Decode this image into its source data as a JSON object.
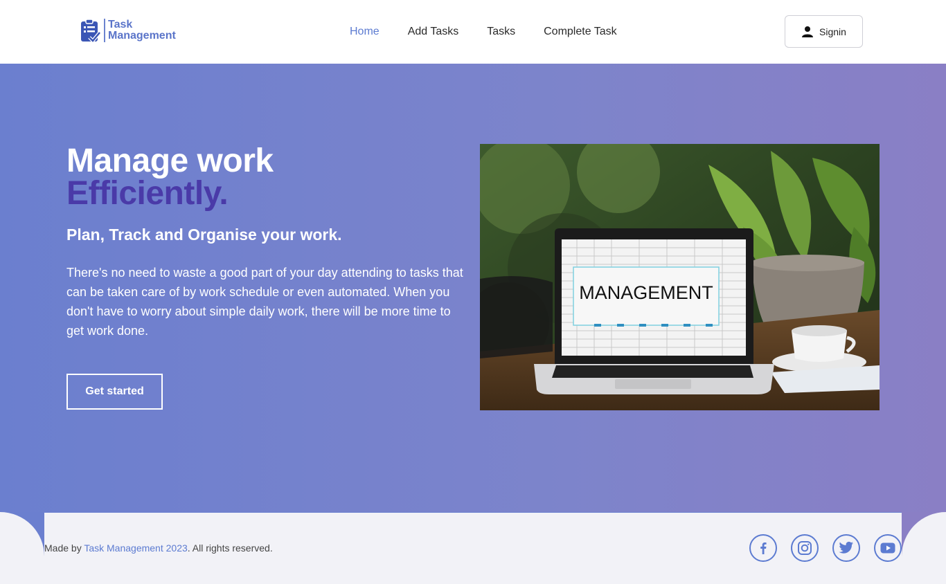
{
  "header": {
    "logo": {
      "line1": "Task",
      "line2": "Management"
    },
    "nav": [
      {
        "label": "Home",
        "active": true
      },
      {
        "label": "Add Tasks",
        "active": false
      },
      {
        "label": "Tasks",
        "active": false
      },
      {
        "label": "Complete Task",
        "active": false
      }
    ],
    "signin_label": "Signin"
  },
  "hero": {
    "title_line1": "Manage work",
    "title_line2": "Efficiently.",
    "subtitle": "Plan, Track and Organise your work.",
    "description": "There's no need to waste a good part of your day attending to tasks that can be taken care of by work schedule or even automated. When you don't have to worry about simple daily work, there will be more time to get work done.",
    "cta_label": "Get started",
    "image_text": "MANAGEMENT"
  },
  "footer": {
    "prefix": "Made by ",
    "brand": "Task Management 2023",
    "suffix": ". All rights reserved.",
    "socials": [
      "facebook-icon",
      "instagram-icon",
      "twitter-icon",
      "youtube-icon"
    ]
  },
  "colors": {
    "accent": "#5c7bd1",
    "hero_gradient_start": "#6b7fcf",
    "hero_gradient_end": "#8a7fc5",
    "title_accent": "#4a3aa8"
  }
}
